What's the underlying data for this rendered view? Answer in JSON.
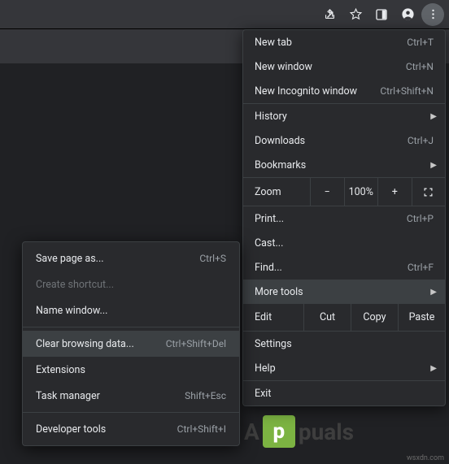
{
  "toolbar": {
    "icons": [
      "share-icon",
      "star-icon",
      "panel-icon",
      "profile-icon",
      "menu-dots-icon"
    ]
  },
  "logo": {
    "prefix": "A",
    "badge": "p",
    "suffix": "puals"
  },
  "credit": "wsxdn.com",
  "menu": {
    "new_tab": "New tab",
    "new_tab_accel": "Ctrl+T",
    "new_window": "New window",
    "new_window_accel": "Ctrl+N",
    "incognito": "New Incognito window",
    "incognito_accel": "Ctrl+Shift+N",
    "history": "History",
    "downloads": "Downloads",
    "downloads_accel": "Ctrl+J",
    "bookmarks": "Bookmarks",
    "zoom_label": "Zoom",
    "zoom_minus": "−",
    "zoom_value": "100%",
    "zoom_plus": "+",
    "print": "Print...",
    "print_accel": "Ctrl+P",
    "cast": "Cast...",
    "find": "Find...",
    "find_accel": "Ctrl+F",
    "more_tools": "More tools",
    "edit": "Edit",
    "cut": "Cut",
    "copy": "Copy",
    "paste": "Paste",
    "settings": "Settings",
    "help": "Help",
    "exit": "Exit"
  },
  "submenu": {
    "save_page": "Save page as...",
    "save_page_accel": "Ctrl+S",
    "create_shortcut": "Create shortcut...",
    "name_window": "Name window...",
    "clear_data": "Clear browsing data...",
    "clear_data_accel": "Ctrl+Shift+Del",
    "extensions": "Extensions",
    "task_manager": "Task manager",
    "task_manager_accel": "Shift+Esc",
    "dev_tools": "Developer tools",
    "dev_tools_accel": "Ctrl+Shift+I"
  }
}
